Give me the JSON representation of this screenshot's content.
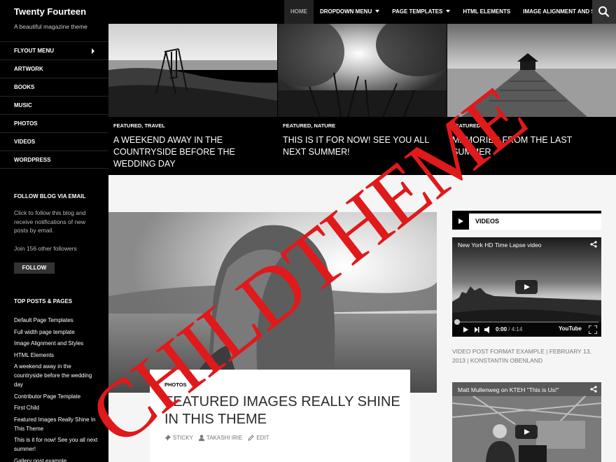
{
  "site": {
    "title": "Twenty Fourteen",
    "description": "A beautiful magazine theme"
  },
  "sidebar": {
    "menu": [
      {
        "label": "FLYOUT MENU",
        "has_submenu": true
      },
      {
        "label": "ARTWORK"
      },
      {
        "label": "BOOKS"
      },
      {
        "label": "MUSIC"
      },
      {
        "label": "PHOTOS"
      },
      {
        "label": "VIDEOS"
      },
      {
        "label": "WORDPRESS"
      }
    ],
    "follow_widget": {
      "title": "FOLLOW BLOG VIA EMAIL",
      "text": "Click to follow this blog and receive notifications of new posts by email.",
      "followers": "Join 156 other followers",
      "button": "FOLLOW"
    },
    "top_posts": {
      "title": "TOP POSTS & PAGES",
      "items": [
        "Default Page Templates",
        "Full width page template",
        "Image Alignment and Styles",
        "HTML Elements",
        "A weekend away in the countryside before the wedding day",
        "Contributor Page Template",
        "First Child",
        "Featured Images Really Shine In This Theme",
        "This is it for now! See you all next summer!",
        "Gallery post example"
      ]
    }
  },
  "nav": {
    "items": [
      {
        "label": "HOME",
        "active": true
      },
      {
        "label": "DROPDOWN MENU",
        "dropdown": true
      },
      {
        "label": "PAGE TEMPLATES",
        "dropdown": true
      },
      {
        "label": "HTML ELEMENTS"
      },
      {
        "label": "IMAGE ALIGNMENT AND STYLES"
      }
    ],
    "search_icon": "search-icon"
  },
  "featured": [
    {
      "category": "FEATURED, TRAVEL",
      "title": "A WEEKEND AWAY IN THE COUNTRYSIDE BEFORE THE WEDDING DAY"
    },
    {
      "category": "FEATURED, NATURE",
      "title": "THIS IS IT FOR NOW! SEE YOU ALL NEXT SUMMER!"
    },
    {
      "category": "FEATURED",
      "title": "MEMORIES FROM THE LAST SUMMER"
    }
  ],
  "post": {
    "category": "PHOTOS",
    "title": "FEATURED IMAGES REALLY SHINE IN THIS THEME",
    "meta": {
      "sticky": "STICKY",
      "author": "TAKASHI IRIE",
      "edit": "EDIT"
    }
  },
  "videos_widget": {
    "title": "VIDEOS",
    "videos": [
      {
        "title": "New York HD Time Lapse video",
        "current": "0:00",
        "duration": "/ 4:14",
        "logo": "YouTube"
      },
      {
        "title": "Matt Mullenweg on KTEH \"This is Us!\""
      }
    ],
    "caption": "VIDEO POST FORMAT EXAMPLE | FEBRUARY 13, 2013 | KONSTANTIN OBENLAND"
  },
  "watermark": "CHILDTHEME"
}
